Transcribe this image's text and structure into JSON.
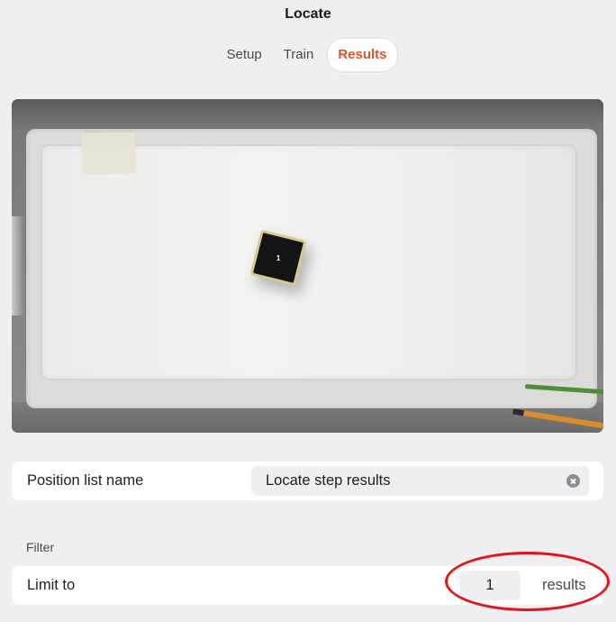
{
  "header": {
    "title": "Locate"
  },
  "tabs": [
    {
      "label": "Setup",
      "active": false
    },
    {
      "label": "Train",
      "active": false
    },
    {
      "label": "Results",
      "active": true
    }
  ],
  "camera": {
    "object_label": "1"
  },
  "position_list": {
    "label": "Position list name",
    "value": "Locate step results"
  },
  "filter": {
    "section_label": "Filter",
    "limit_label": "Limit to",
    "limit_value": "1",
    "limit_suffix": "results"
  },
  "colors": {
    "accent": "#d9542b",
    "background": "#efeff1",
    "annotation_ring": "#e3141b"
  },
  "icons": {
    "clear_field": "close-circle-icon"
  }
}
